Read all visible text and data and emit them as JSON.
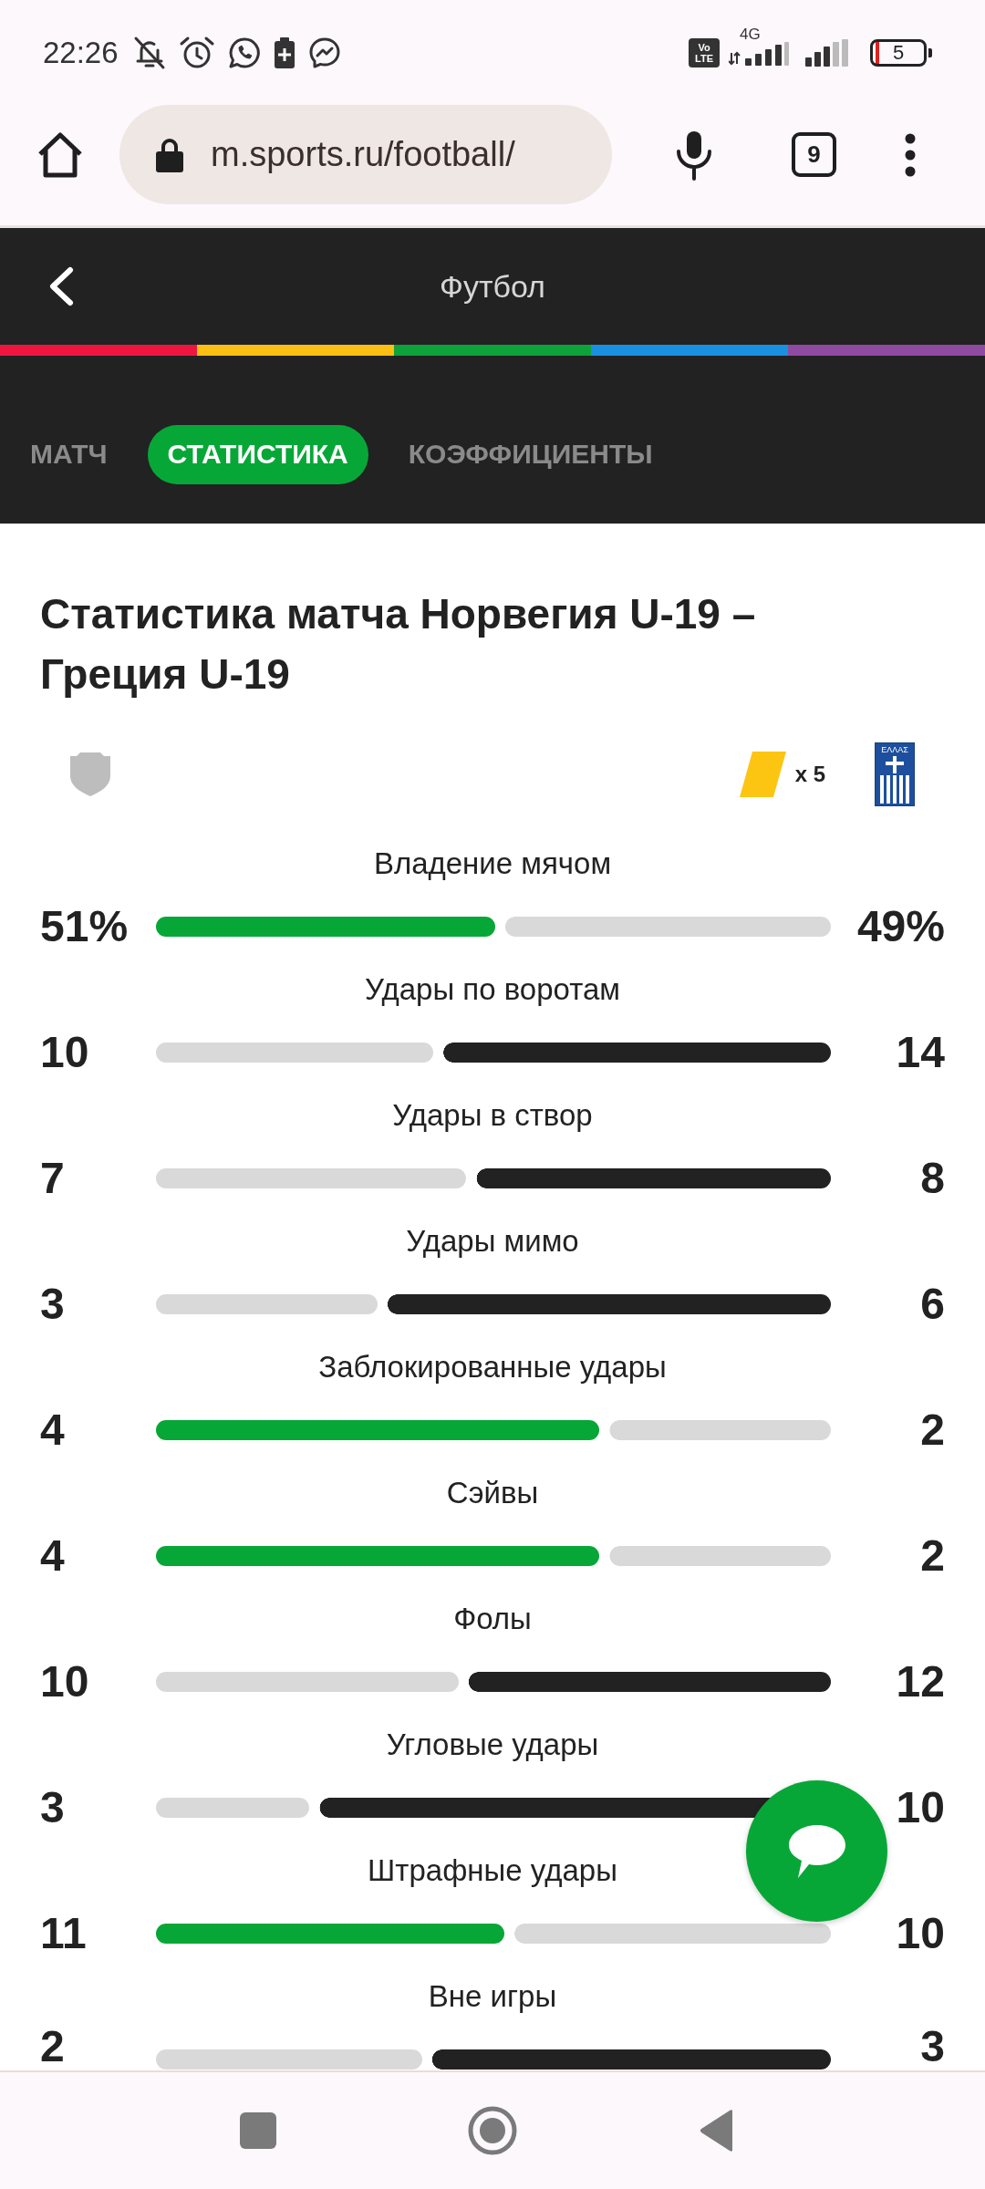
{
  "status_bar": {
    "time": "22:26",
    "volte": [
      "Vo",
      "LTE"
    ],
    "network": "4G",
    "battery": "5"
  },
  "browser": {
    "url": "m.sports.ru/football/",
    "tab_count": "9"
  },
  "header": {
    "title": "Футбол"
  },
  "tabs": [
    {
      "label": "МАТЧ",
      "selected": false
    },
    {
      "label": "СТАТИСТИКА",
      "selected": true
    },
    {
      "label": "КОЭФФИЦИЕНТЫ",
      "selected": false
    }
  ],
  "match": {
    "title": "Статистика матча Норвегия U-19 – Греция U-19",
    "away_cards": "x 5",
    "away_crest_text": "ΕΛΛΑΣ"
  },
  "stats": [
    {
      "label": "Владение мячом",
      "home": "51%",
      "away": "49%",
      "level": 0.51,
      "home_leads": true
    },
    {
      "label": "Удары по воротам",
      "home": "10",
      "away": "14",
      "level": 0.417,
      "home_leads": false
    },
    {
      "label": "Удары в створ",
      "home": "7",
      "away": "8",
      "level": 0.467,
      "home_leads": false
    },
    {
      "label": "Удары мимо",
      "home": "3",
      "away": "6",
      "level": 0.333,
      "home_leads": false
    },
    {
      "label": "Заблокированные удары",
      "home": "4",
      "away": "2",
      "level": 0.667,
      "home_leads": true
    },
    {
      "label": "Сэйвы",
      "home": "4",
      "away": "2",
      "level": 0.667,
      "home_leads": true
    },
    {
      "label": "Фолы",
      "home": "10",
      "away": "12",
      "level": 0.455,
      "home_leads": false
    },
    {
      "label": "Угловые удары",
      "home": "3",
      "away": "10",
      "level": 0.231,
      "home_leads": false
    },
    {
      "label": "Штрафные удары",
      "home": "11",
      "away": "10",
      "level": 0.524,
      "home_leads": true
    },
    {
      "label": "Вне игры",
      "home": "2",
      "away": "3",
      "level": 0.4,
      "home_leads": false
    }
  ]
}
